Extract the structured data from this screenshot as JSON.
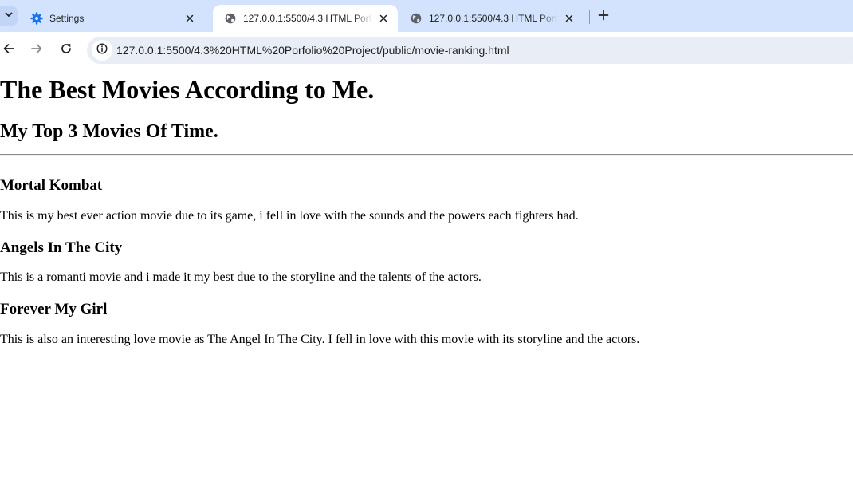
{
  "browser": {
    "tabs": [
      {
        "title": "Settings",
        "active": false,
        "icon": "settings-gear-icon"
      },
      {
        "title": "127.0.0.1:5500/4.3 HTML Porfolio Project/public/movie-ranking.html",
        "active": true,
        "icon": "globe-icon"
      },
      {
        "title": "127.0.0.1:5500/4.3 HTML Porfolio Project/public/movie-ranking.html",
        "active": false,
        "icon": "globe-icon"
      }
    ],
    "url": "127.0.0.1:5500/4.3%20HTML%20Porfolio%20Project/public/movie-ranking.html",
    "colors": {
      "tabstrip": "#d3e3fd",
      "omnibox": "#e9eef6",
      "accent": "#1a73e8"
    }
  },
  "page": {
    "heading": "The Best Movies According to Me.",
    "subheading": "My Top 3 Movies Of Time.",
    "movies": [
      {
        "title": "Mortal Kombat",
        "description": "This is my best ever action movie due to its game, i fell in love with the sounds and the powers each fighters had."
      },
      {
        "title": "Angels In The City",
        "description": "This is a romanti movie and i made it my best due to the storyline and the talents of the actors."
      },
      {
        "title": "Forever My Girl",
        "description": "This is also an interesting love movie as The Angel In The City. I fell in love with this movie with its storyline and the actors."
      }
    ]
  }
}
